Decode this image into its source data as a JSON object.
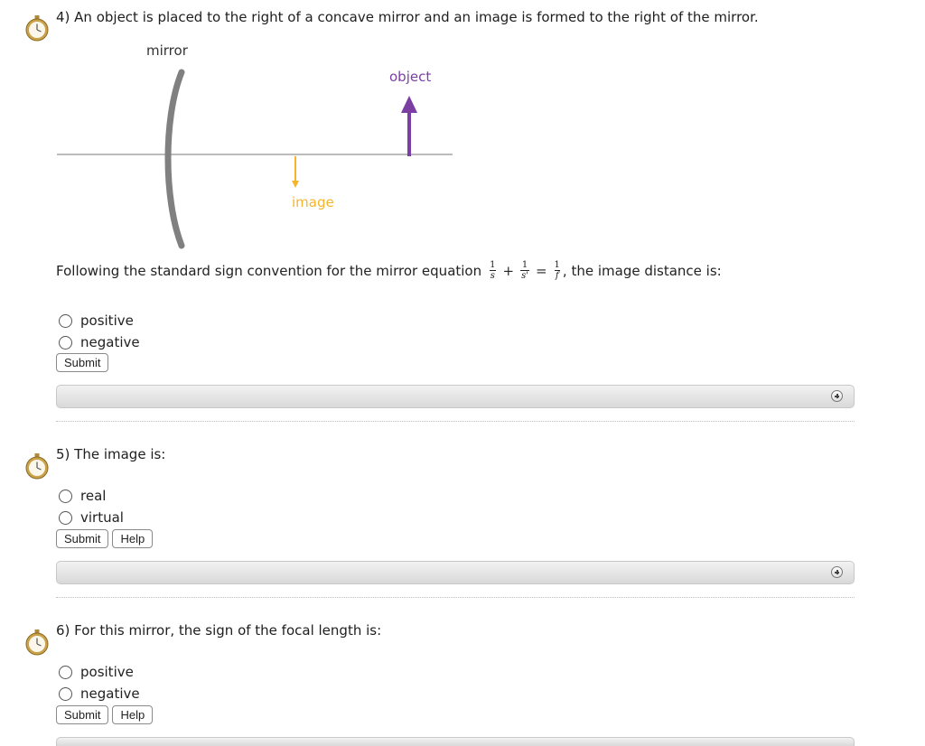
{
  "q4": {
    "text": "4) An object is placed to the right of a concave mirror and an image is formed to the right of the mirror.",
    "diagram": {
      "mirror_label": "mirror",
      "object_label": "object",
      "image_label": "image",
      "object_color": "#7b3fa3",
      "image_color": "#f5b52b"
    },
    "prompt_before": "Following the standard sign convention for the mirror equation",
    "equation": {
      "one_1": "1",
      "s": "s",
      "plus": "+",
      "one_2": "1",
      "s_prime": "s'",
      "equals": "=",
      "one_3": "1",
      "f": "f"
    },
    "prompt_after": ", the image distance is:",
    "options": [
      "positive",
      "negative"
    ],
    "submit_label": "Submit"
  },
  "q5": {
    "text": "5) The image is:",
    "options": [
      "real",
      "virtual"
    ],
    "submit_label": "Submit",
    "help_label": "Help"
  },
  "q6": {
    "text": "6) For this mirror, the sign of the focal length is:",
    "options": [
      "positive",
      "negative"
    ],
    "submit_label": "Submit",
    "help_label": "Help"
  }
}
